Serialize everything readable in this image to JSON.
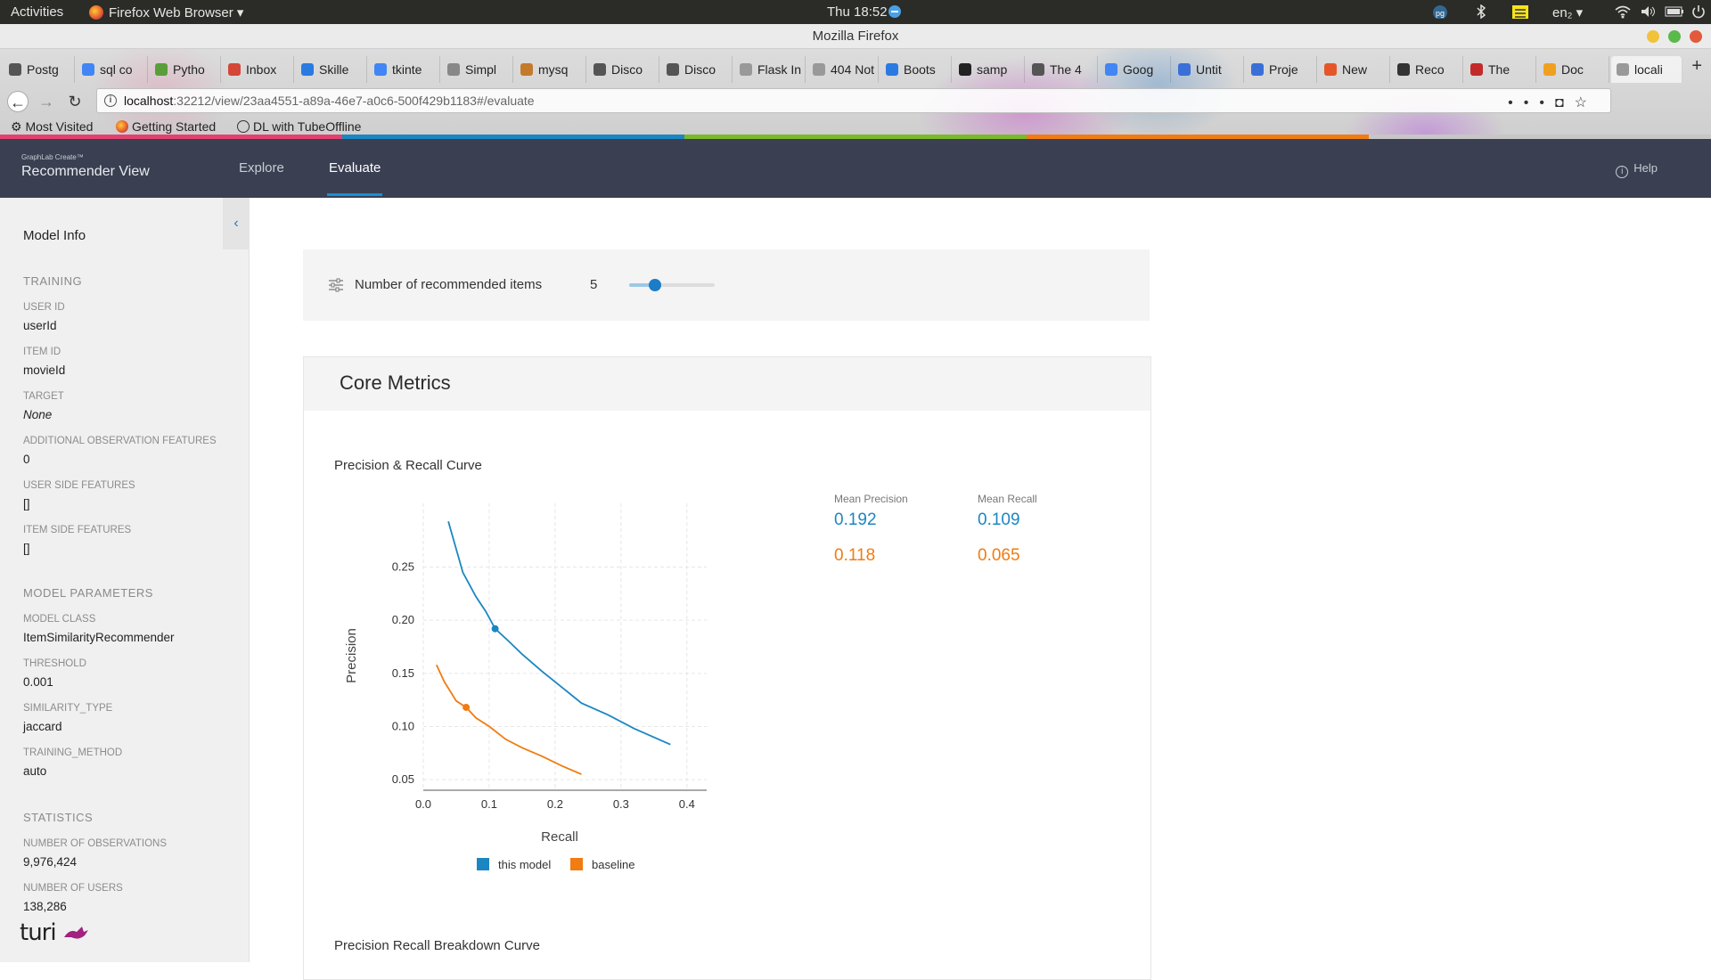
{
  "system": {
    "activities": "Activities",
    "app_menu": "Firefox Web Browser ▾",
    "clock": "Thu 18:52",
    "lang": "en₂ ▾"
  },
  "window": {
    "title": "Mozilla Firefox"
  },
  "tabs": [
    {
      "label": "Postg",
      "color": "#555"
    },
    {
      "label": "sql co",
      "color": "#4285f4"
    },
    {
      "label": "Pytho",
      "color": "#5a9e3a"
    },
    {
      "label": "Inbox",
      "color": "#d44638"
    },
    {
      "label": "Skille",
      "color": "#2a7ae2"
    },
    {
      "label": "tkinte",
      "color": "#4285f4"
    },
    {
      "label": "Simpl",
      "color": "#888"
    },
    {
      "label": "mysq",
      "color": "#c47a2c"
    },
    {
      "label": "Disco",
      "color": "#555"
    },
    {
      "label": "Disco",
      "color": "#555"
    },
    {
      "label": "Flask In",
      "color": "#999"
    },
    {
      "label": "404 Not",
      "color": "#999"
    },
    {
      "label": "Boots",
      "color": "#2a7ae2"
    },
    {
      "label": "samp",
      "color": "#222"
    },
    {
      "label": "The 4",
      "color": "#555"
    },
    {
      "label": "Goog",
      "color": "#4285f4"
    },
    {
      "label": "Untit",
      "color": "#3b6fd8"
    },
    {
      "label": "Proje",
      "color": "#3b6fd8"
    },
    {
      "label": "New",
      "color": "#e5572a"
    },
    {
      "label": "Reco",
      "color": "#333"
    },
    {
      "label": "The",
      "color": "#c32b2b"
    },
    {
      "label": "Doc",
      "color": "#f0a020"
    },
    {
      "label": "locali",
      "color": "#999"
    }
  ],
  "url": {
    "host": "localhost",
    "path": ":32212/view/23aa4551-a89a-46e7-a0c6-500f429b1183#/evaluate"
  },
  "bookmarks": [
    "Most Visited",
    "Getting Started",
    "DL with TubeOffline"
  ],
  "header": {
    "brand_small": "GraphLab Create™",
    "brand_title": "Recommender View",
    "nav": [
      "Explore",
      "Evaluate"
    ],
    "active_nav": "Evaluate",
    "help": "Help"
  },
  "sidebar": {
    "title": "Model Info",
    "training": {
      "heading": "TRAINING",
      "fields": [
        {
          "label": "USER ID",
          "value": "userId"
        },
        {
          "label": "ITEM ID",
          "value": "movieId"
        },
        {
          "label": "TARGET",
          "value": "None"
        },
        {
          "label": "ADDITIONAL OBSERVATION FEATURES",
          "value": "0"
        },
        {
          "label": "USER SIDE FEATURES",
          "value": "[]"
        },
        {
          "label": "ITEM SIDE FEATURES",
          "value": "[]"
        }
      ]
    },
    "model_parameters": {
      "heading": "MODEL PARAMETERS",
      "fields": [
        {
          "label": "MODEL CLASS",
          "value": "ItemSimilarityRecommender"
        },
        {
          "label": "THRESHOLD",
          "value": "0.001"
        },
        {
          "label": "SIMILARITY_TYPE",
          "value": "jaccard"
        },
        {
          "label": "TRAINING_METHOD",
          "value": "auto"
        }
      ]
    },
    "statistics": {
      "heading": "STATISTICS",
      "fields": [
        {
          "label": "NUMBER OF OBSERVATIONS",
          "value": "9,976,424"
        },
        {
          "label": "NUMBER OF USERS",
          "value": "138,286"
        }
      ]
    },
    "logo": "turi"
  },
  "settings": {
    "label": "Number of recommended items",
    "value": "5",
    "slider_fraction": 0.3
  },
  "metrics": {
    "title": "Core Metrics",
    "chart_title": "Precision & Recall Curve",
    "mean_precision_label": "Mean Precision",
    "mean_recall_label": "Mean Recall",
    "model_stats": {
      "precision": "0.192",
      "recall": "0.109"
    },
    "baseline_stats": {
      "precision": "0.118",
      "recall": "0.065"
    },
    "breakdown_title": "Precision Recall Breakdown Curve"
  },
  "colors": {
    "model": "#1c86c2",
    "baseline": "#f07c12",
    "header_bg": "#3a3f51",
    "accent": "#1890d6"
  },
  "chart_data": {
    "type": "line",
    "xlabel": "Recall",
    "ylabel": "Precision",
    "xlim": [
      0,
      0.43
    ],
    "ylim": [
      0.04,
      0.31
    ],
    "xticks": [
      "0.0",
      "0.1",
      "0.2",
      "0.3",
      "0.4"
    ],
    "xtick_values": [
      0,
      0.1,
      0.2,
      0.3,
      0.4
    ],
    "yticks": [
      "0.05",
      "0.10",
      "0.15",
      "0.20",
      "0.25"
    ],
    "ytick_values": [
      0.05,
      0.1,
      0.15,
      0.2,
      0.25
    ],
    "grid": true,
    "legend_position": "bottom",
    "series": [
      {
        "name": "this model",
        "color": "#1c86c2",
        "x": [
          0.038,
          0.06,
          0.08,
          0.095,
          0.109,
          0.13,
          0.15,
          0.18,
          0.21,
          0.24,
          0.28,
          0.32,
          0.375
        ],
        "y": [
          0.293,
          0.245,
          0.222,
          0.208,
          0.192,
          0.18,
          0.168,
          0.152,
          0.137,
          0.122,
          0.111,
          0.098,
          0.083
        ],
        "marker": {
          "x": 0.109,
          "y": 0.192
        }
      },
      {
        "name": "baseline",
        "color": "#f07c12",
        "x": [
          0.02,
          0.032,
          0.05,
          0.065,
          0.08,
          0.1,
          0.125,
          0.15,
          0.18,
          0.21,
          0.24
        ],
        "y": [
          0.158,
          0.142,
          0.124,
          0.118,
          0.108,
          0.1,
          0.088,
          0.08,
          0.072,
          0.063,
          0.055
        ],
        "marker": {
          "x": 0.065,
          "y": 0.118
        }
      }
    ]
  }
}
